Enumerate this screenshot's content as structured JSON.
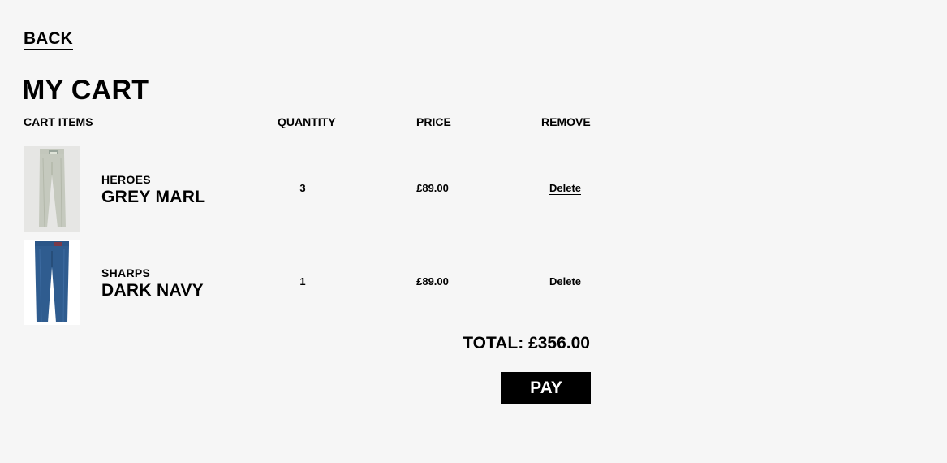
{
  "nav": {
    "back_label": "BACK"
  },
  "page": {
    "title": "MY CART"
  },
  "table": {
    "headers": {
      "items": "CART ITEMS",
      "quantity": "QUANTITY",
      "price": "PRICE",
      "remove": "REMOVE"
    },
    "rows": [
      {
        "brand": "HEROES",
        "variant": "GREY MARL",
        "quantity": "3",
        "price": "£89.00",
        "remove_label": "Delete",
        "image": "grey-chino-trousers"
      },
      {
        "brand": "SHARPS",
        "variant": "DARK NAVY",
        "quantity": "1",
        "price": "£89.00",
        "remove_label": "Delete",
        "image": "dark-navy-jeans"
      }
    ]
  },
  "summary": {
    "total_label": "TOTAL: £356.00",
    "pay_label": "PAY"
  },
  "colors": {
    "background": "#f6f6f6",
    "text": "#000000",
    "button_bg": "#000000",
    "button_text": "#ffffff",
    "grey_marl": "#c7cbc0",
    "dark_navy": "#2e5a8c"
  }
}
